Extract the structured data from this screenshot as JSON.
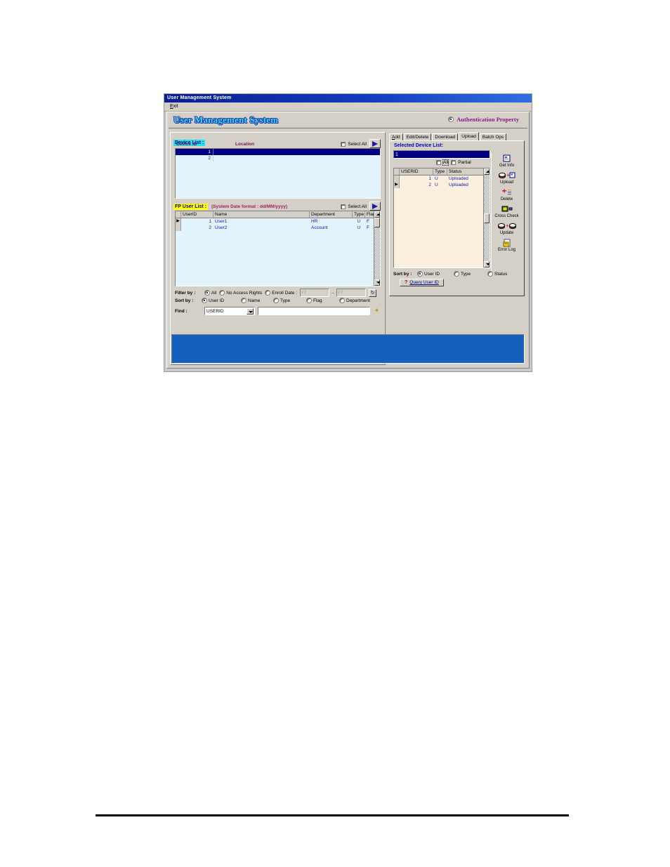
{
  "window": {
    "title": "User Management System",
    "menu": [
      "Exit"
    ]
  },
  "header": {
    "app_heading": "User Management System",
    "auth_property_label": "Authentication Property",
    "auth_property_selected": true,
    "heading_color": "#28e0ea",
    "auth_color": "#8b1a8b"
  },
  "device_list": {
    "label": "Device List :",
    "label_bg": "#22e3e9",
    "select_all_label": "Select All",
    "select_all_checked": false,
    "columns": [
      "Device ID",
      "Location"
    ],
    "rows": [
      {
        "device_id": "1",
        "location": "",
        "selected": true
      },
      {
        "device_id": "2",
        "location": "",
        "selected": false
      }
    ]
  },
  "fp_user_list": {
    "label": "FP User List :",
    "label_bg": "#ffff00",
    "note": "(System Date format : dd/MM/yyyy)",
    "select_all_label": "Select All",
    "select_all_checked": false,
    "columns": [
      "UserID",
      "Name",
      "Department",
      "Type",
      "Flag"
    ],
    "rows": [
      {
        "userid": "1",
        "name": "User1",
        "department": "HR",
        "type": "U",
        "flag": "F"
      },
      {
        "userid": "2",
        "name": "User2",
        "department": "Account",
        "type": "U",
        "flag": "F"
      }
    ]
  },
  "filter": {
    "label": "Filter by :",
    "options": [
      {
        "label": "All",
        "selected": true
      },
      {
        "label": "No Access Rights",
        "selected": false
      },
      {
        "label": "Enroll Date :",
        "selected": false
      }
    ],
    "date_from": "/   /",
    "date_to": "/   /",
    "separator": "-",
    "refresh_icon": "refresh-icon"
  },
  "sort_left": {
    "label": "Sort by :",
    "options": [
      {
        "label": "User ID",
        "selected": true
      },
      {
        "label": "Name",
        "selected": false
      },
      {
        "label": "Type",
        "selected": false
      },
      {
        "label": "Flag",
        "selected": false
      },
      {
        "label": "Department",
        "selected": false
      }
    ]
  },
  "find": {
    "label": "Find :",
    "field_value": "USERID",
    "field_options": [
      "USERID"
    ],
    "text_value": "",
    "text_placeholder": "",
    "action_icon": "wand-icon"
  },
  "tabs": [
    {
      "label": "Add",
      "active": false
    },
    {
      "label": "Edit/Delete",
      "active": false
    },
    {
      "label": "Download",
      "active": false
    },
    {
      "label": "Upload",
      "active": true
    },
    {
      "label": "Batch Ops",
      "active": false
    }
  ],
  "upload_tab": {
    "selected_device_label": "Selected Device List:",
    "selected_device_value": "1",
    "mode_all_label": "All",
    "mode_all_checked": false,
    "mode_partial_label": "Partial",
    "mode_partial_checked": false,
    "columns": [
      "USERID",
      "Type",
      "Status"
    ],
    "rows": [
      {
        "userid": "1",
        "type": "U",
        "status": "Uploaded"
      },
      {
        "userid": "2",
        "type": "U",
        "status": "Uploaded"
      }
    ],
    "sort": {
      "label": "Sort by :",
      "options": [
        {
          "label": "User ID",
          "selected": true
        },
        {
          "label": "Type",
          "selected": false
        },
        {
          "label": "Status",
          "selected": false
        }
      ]
    },
    "query_button": "Query User ID",
    "query_icon": "question-icon"
  },
  "toolbar": [
    {
      "label": "Get Info",
      "icon": "get-info-icon"
    },
    {
      "label": "Upload",
      "icon": "upload-icon"
    },
    {
      "label": "Delete",
      "icon": "delete-icon"
    },
    {
      "label": "Cross Check",
      "icon": "cross-check-icon"
    },
    {
      "label": "Update",
      "icon": "update-icon"
    },
    {
      "label": "Error Log",
      "icon": "error-log-icon"
    }
  ],
  "status_panel": {
    "text": "",
    "color": "#1560bd"
  }
}
